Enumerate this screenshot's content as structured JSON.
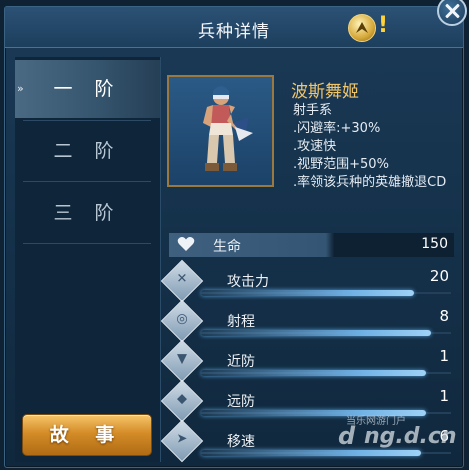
{
  "header": {
    "title": "兵种详情",
    "hint_mark": "!"
  },
  "sidebar": {
    "tiers": [
      {
        "label": "一 阶",
        "active": true
      },
      {
        "label": "二 阶",
        "active": false
      },
      {
        "label": "三 阶",
        "active": false
      }
    ],
    "story_button": "故 事"
  },
  "unit": {
    "name": "波斯舞姬",
    "lines": [
      ".闪避率:+30%",
      ".攻速快",
      ".视野范围+50%",
      ".率领该兵种的英雄撤退CD"
    ],
    "type": "射手系"
  },
  "stats": {
    "hp": {
      "label": "生命",
      "value": "150",
      "icon": "heart-icon"
    },
    "rows": [
      {
        "label": "攻击力",
        "value": "20",
        "icon": "sword-icon",
        "level": 0.85
      },
      {
        "label": "射程",
        "value": "8",
        "icon": "target-icon",
        "level": 0.92
      },
      {
        "label": "近防",
        "value": "1",
        "icon": "armor-icon",
        "level": 0.9
      },
      {
        "label": "远防",
        "value": "1",
        "icon": "shield-icon",
        "level": 0.9
      },
      {
        "label": "移速",
        "value": "6",
        "icon": "boot-icon",
        "level": 0.88
      }
    ]
  },
  "watermark": {
    "top": "当乐网游门户",
    "big": "ng.d.cn",
    "logo": "d"
  },
  "colors": {
    "accent_gold": "#f1c66b",
    "story_button": "#d48c28",
    "panel": "#1b3a56"
  }
}
